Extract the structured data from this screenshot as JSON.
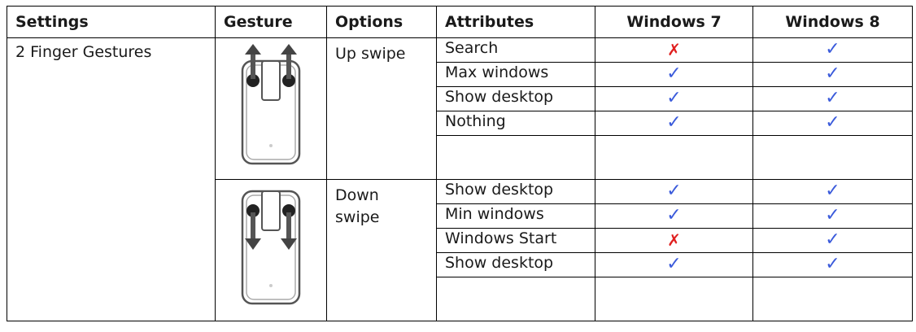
{
  "headers": [
    "Settings",
    "Gesture",
    "Options",
    "Attributes",
    "Windows 7",
    "Windows 8"
  ],
  "setting": "2 Finger Gestures",
  "groups": [
    {
      "gesture_icon": "two-finger-up-swipe-icon",
      "option": "Up swipe",
      "rows": [
        {
          "attribute": "Search",
          "win7": "✗",
          "win8": "✓"
        },
        {
          "attribute": "Max windows",
          "win7": "✓",
          "win8": "✓"
        },
        {
          "attribute": "Show desktop",
          "win7": "✓",
          "win8": "✓"
        },
        {
          "attribute": "Nothing",
          "win7": "✓",
          "win8": "✓"
        }
      ]
    },
    {
      "gesture_icon": "two-finger-down-swipe-icon",
      "option": "Down swipe",
      "rows": [
        {
          "attribute": "Show desktop",
          "win7": "✓",
          "win8": "✓"
        },
        {
          "attribute": "Min windows",
          "win7": "✓",
          "win8": "✓"
        },
        {
          "attribute": "Windows Start",
          "win7": "✗",
          "win8": "✓"
        },
        {
          "attribute": "Show desktop",
          "win7": "✓",
          "win8": "✓"
        }
      ]
    }
  ],
  "colors": {
    "check": "#3b5bdb",
    "cross": "#e02020"
  }
}
